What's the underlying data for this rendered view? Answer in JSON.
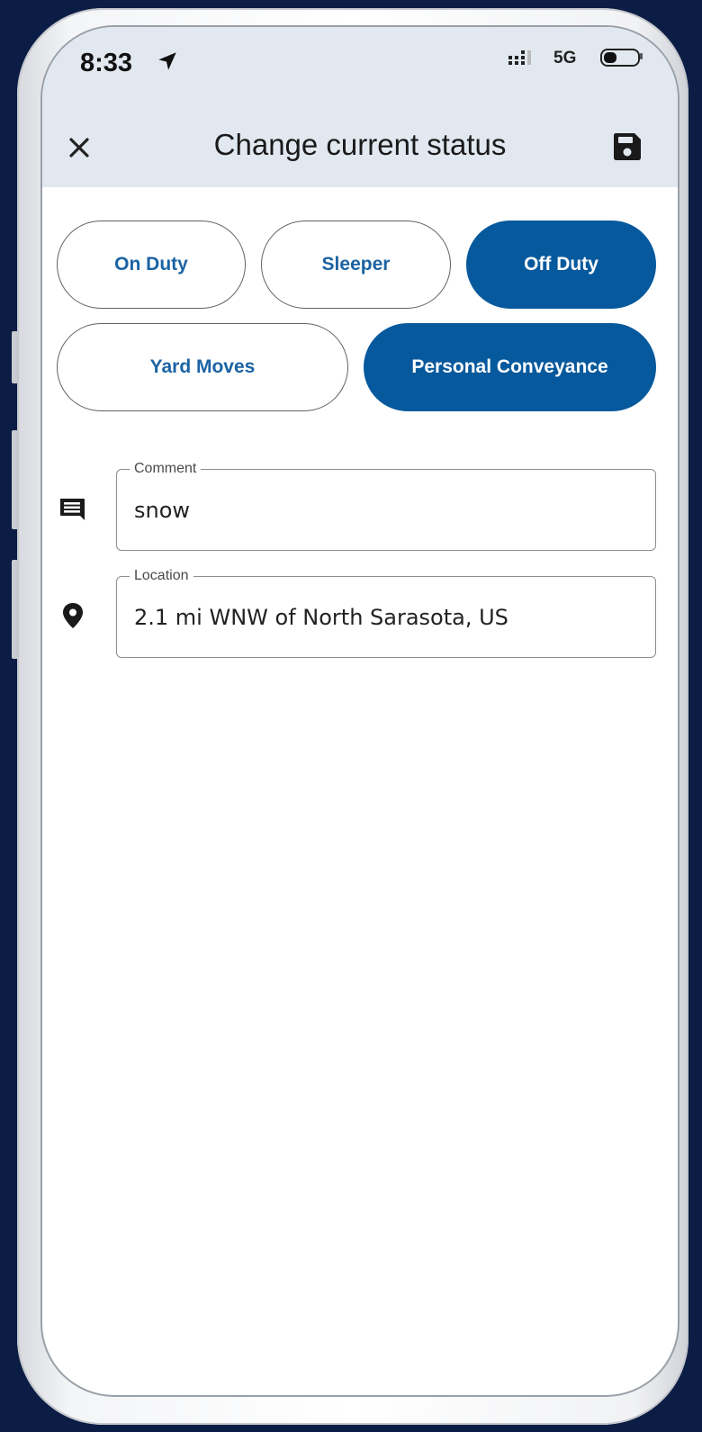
{
  "status_bar": {
    "time": "8:33",
    "network": "5G"
  },
  "header": {
    "title": "Change current status",
    "close_icon": "close-icon",
    "save_icon": "save-icon"
  },
  "status_options": [
    {
      "label": "On Duty",
      "selected": false
    },
    {
      "label": "Sleeper",
      "selected": false
    },
    {
      "label": "Off Duty",
      "selected": true
    },
    {
      "label": "Yard Moves",
      "selected": false
    },
    {
      "label": "Personal Conveyance",
      "selected": true
    }
  ],
  "comment": {
    "label": "Comment",
    "value": "snow",
    "icon": "comment-icon"
  },
  "location": {
    "label": "Location",
    "value": "2.1 mi WNW of North Sarasota, US",
    "icon": "location-pin-icon"
  },
  "colors": {
    "accent": "#07599d",
    "header_bg": "#e1e8f0",
    "background": "#0b1d44"
  }
}
